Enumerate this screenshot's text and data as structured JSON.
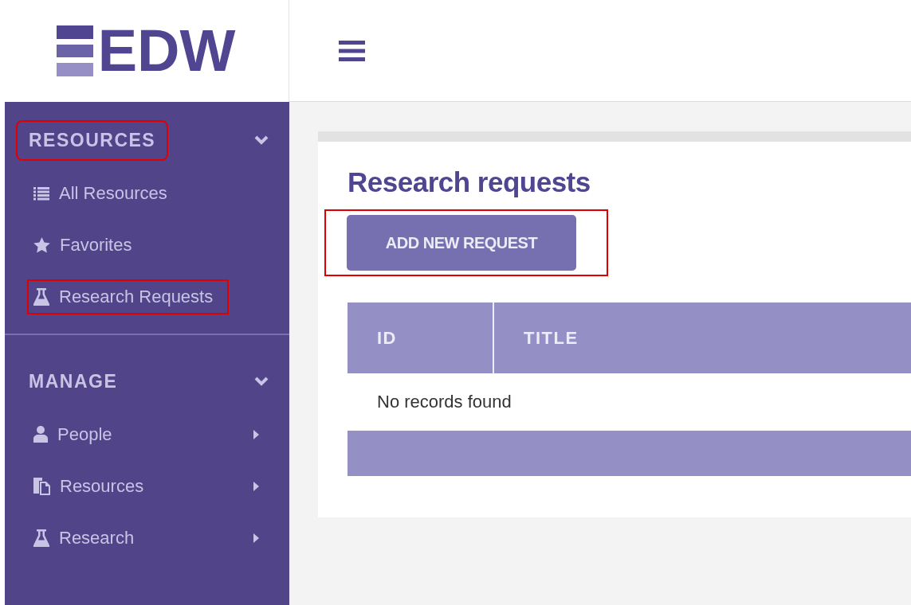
{
  "logo": {
    "text": "EDW"
  },
  "sidebar": {
    "sections": [
      {
        "title": "RESOURCES",
        "expanded": true,
        "highlighted": true,
        "items": [
          {
            "label": "All Resources",
            "kind": "list",
            "has_submenu": false,
            "highlighted": false
          },
          {
            "label": "Favorites",
            "kind": "star",
            "has_submenu": false,
            "highlighted": false
          },
          {
            "label": "Research Requests",
            "kind": "flask",
            "has_submenu": false,
            "highlighted": true
          }
        ]
      },
      {
        "title": "MANAGE",
        "expanded": true,
        "highlighted": false,
        "items": [
          {
            "label": "People",
            "kind": "person",
            "has_submenu": true,
            "highlighted": false
          },
          {
            "label": "Resources",
            "kind": "files",
            "has_submenu": true,
            "highlighted": false
          },
          {
            "label": "Research",
            "kind": "flask",
            "has_submenu": true,
            "highlighted": false
          }
        ]
      }
    ]
  },
  "page": {
    "title": "Research requests",
    "add_button": {
      "label": "ADD NEW REQUEST",
      "highlighted": true
    },
    "table": {
      "columns": [
        "ID",
        "TITLE"
      ],
      "empty_message": "No records found"
    }
  }
}
